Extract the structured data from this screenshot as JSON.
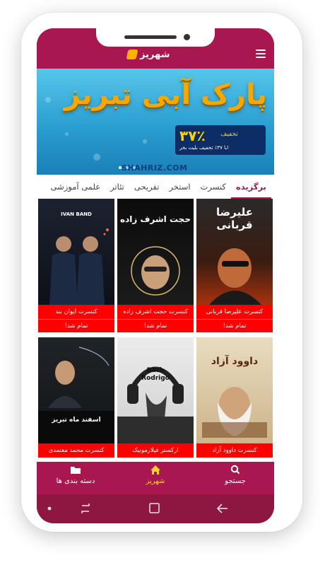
{
  "app": {
    "logo_text": "شهریز",
    "accent": "#a8174f",
    "status_color": "#ff0000",
    "active_color": "#ffcf33"
  },
  "banner": {
    "title": "پارک آبی تبریز",
    "discount_value": "۳۷٪",
    "discount_label": "تخفیف",
    "discount_note": "با ۳۷٪ تخفیف بلیت بخر!",
    "brand": "SHAHRIZ.COM"
  },
  "tabs": [
    {
      "label": "برگزیده",
      "active": true
    },
    {
      "label": "کنسرت",
      "active": false
    },
    {
      "label": "استخر",
      "active": false
    },
    {
      "label": "تفریحی",
      "active": false
    },
    {
      "label": "تئاتر",
      "active": false
    },
    {
      "label": "علمی آموزشی",
      "active": false
    }
  ],
  "cards": [
    {
      "title": "کنسرت علیرضا قربانی",
      "status": "تمام شد!",
      "poster_text": "علیرضا قربانی"
    },
    {
      "title": "کنسرت حجت اشرف زاده",
      "status": "تمام شد!",
      "poster_text": "حجت اشرف زاده"
    },
    {
      "title": "کنسرت ایوان بند",
      "status": "تمام شد!",
      "poster_text": "IVAN BAND"
    },
    {
      "title": "کنسرت داوود آزاد",
      "status": "",
      "poster_text": "داوود آزاد"
    },
    {
      "title": "ارکستر فیلارمونیک",
      "status": "",
      "poster_text": "Bach Rodrigo"
    },
    {
      "title": "کنسرت محمد معتمدی",
      "status": "",
      "poster_text": "اسفند ماه تبریز"
    }
  ],
  "bottom_nav": [
    {
      "label": "جستجو",
      "icon": "search-icon"
    },
    {
      "label": "شهریز",
      "icon": "home-icon",
      "active": true
    },
    {
      "label": "دسته بندی ها",
      "icon": "folder-icon"
    }
  ]
}
